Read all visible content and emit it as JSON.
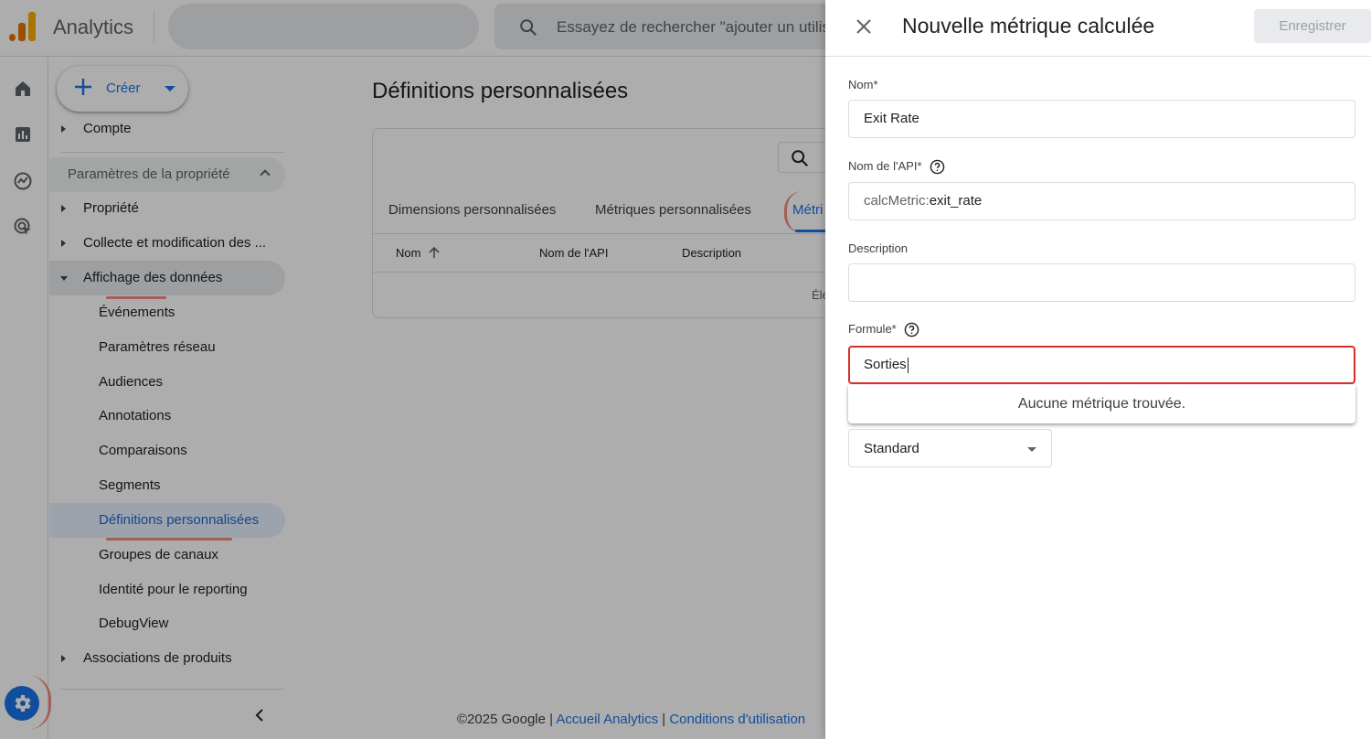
{
  "app": {
    "title": "Analytics",
    "search_placeholder": "Essayez de rechercher \"ajouter un utilisateur\""
  },
  "nav": {
    "create_label": "Créer",
    "items": [
      {
        "label": "Compte"
      },
      {
        "label": "Paramètres de la propriété"
      },
      {
        "label": "Propriété"
      },
      {
        "label": "Collecte et modification des ..."
      },
      {
        "label": "Affichage des données"
      },
      {
        "label": "Événements"
      },
      {
        "label": "Paramètres réseau"
      },
      {
        "label": "Audiences"
      },
      {
        "label": "Annotations"
      },
      {
        "label": "Comparaisons"
      },
      {
        "label": "Segments"
      },
      {
        "label": "Définitions personnalisées"
      },
      {
        "label": "Groupes de canaux"
      },
      {
        "label": "Identité pour le reporting"
      },
      {
        "label": "DebugView"
      },
      {
        "label": "Associations de produits"
      }
    ]
  },
  "main": {
    "title": "Définitions personnalisées",
    "tabs": [
      {
        "label": "Dimensions personnalisées"
      },
      {
        "label": "Métriques personnalisées"
      },
      {
        "label": "Métri"
      }
    ],
    "columns": [
      "Nom",
      "Nom de l'API",
      "Description"
    ],
    "empty_row": "Éle"
  },
  "footer": {
    "copyright": "©2025 Google |",
    "link_home": "Accueil Analytics",
    "sep": "|",
    "link_terms": "Conditions d'utilisation"
  },
  "panel": {
    "title": "Nouvelle métrique calculée",
    "save_label": "Enregistrer",
    "name_label": "Nom*",
    "name_value": "Exit Rate",
    "api_label": "Nom de l'API*",
    "api_prefix": "calcMetric:",
    "api_value": "exit_rate",
    "desc_label": "Description",
    "desc_value": "",
    "formula_label": "Formule*",
    "formula_value": "Sorties",
    "no_results": "Aucune métrique trouvée.",
    "type_value": "Standard"
  },
  "colors": {
    "accent": "#1a73e8",
    "error": "#d93025",
    "highlight_mark": "#f28b82"
  }
}
